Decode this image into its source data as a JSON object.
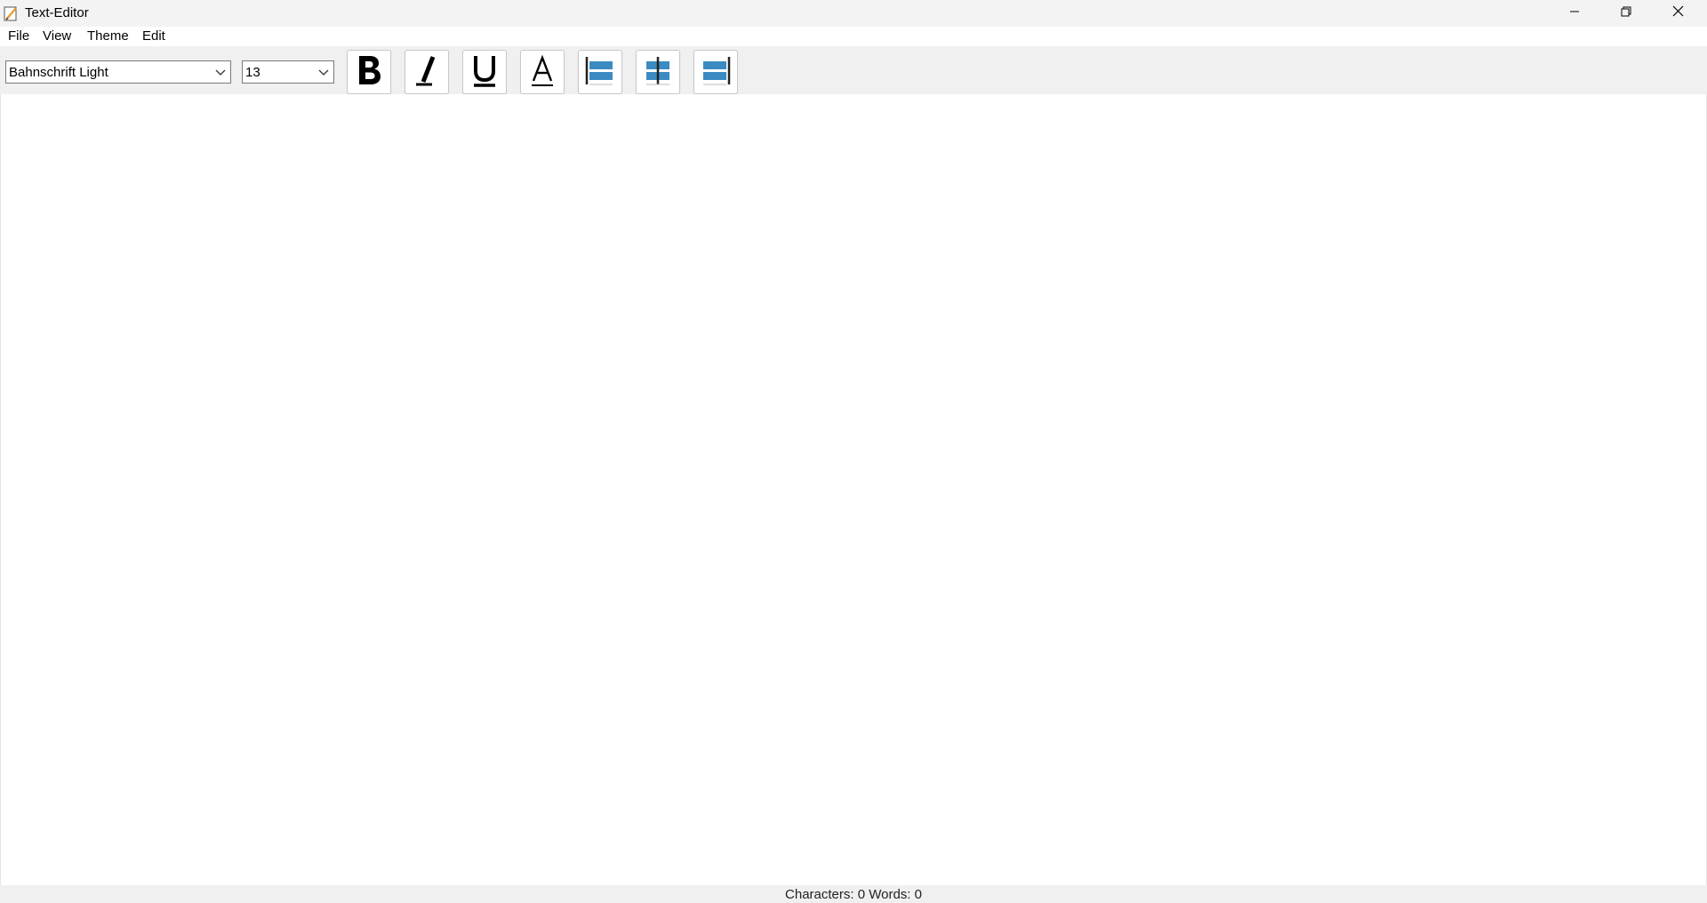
{
  "window": {
    "title": "Text-Editor",
    "controls": {
      "minimize": "minimize-icon",
      "maximize": "restore-icon",
      "close": "close-icon"
    }
  },
  "menu": {
    "items": [
      {
        "label": "File"
      },
      {
        "label": "View"
      },
      {
        "label": "Theme"
      },
      {
        "label": "Edit"
      }
    ]
  },
  "toolbar": {
    "font_family": {
      "value": "Bahnschrift Light"
    },
    "font_size": {
      "value": "13"
    },
    "buttons": [
      {
        "name": "bold",
        "icon": "bold-icon"
      },
      {
        "name": "italic",
        "icon": "italic-icon"
      },
      {
        "name": "underline",
        "icon": "underline-icon"
      },
      {
        "name": "font-color",
        "icon": "font-color-icon"
      },
      {
        "name": "align-left",
        "icon": "align-left-icon"
      },
      {
        "name": "align-center",
        "icon": "align-center-icon"
      },
      {
        "name": "align-right",
        "icon": "align-right-icon"
      }
    ],
    "align_icon_color": "#3b8bc2"
  },
  "editor": {
    "content": ""
  },
  "status": {
    "text": "Characters: 0 Words: 0"
  }
}
